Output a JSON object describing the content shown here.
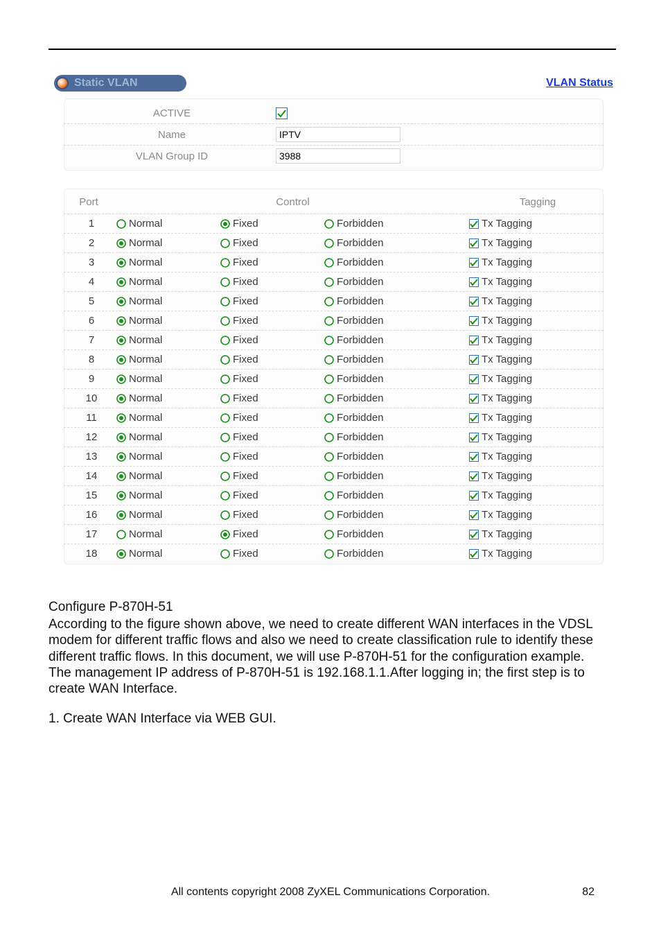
{
  "header": {
    "tab_label": "Static VLAN",
    "link_label": "VLAN Status"
  },
  "form": {
    "active_label": "ACTIVE",
    "active_checked": true,
    "name_label": "Name",
    "name_value": "IPTV",
    "group_label": "VLAN Group ID",
    "group_value": "3988"
  },
  "table": {
    "head_port": "Port",
    "head_control": "Control",
    "head_tagging": "Tagging",
    "opt_normal": "Normal",
    "opt_fixed": "Fixed",
    "opt_forbidden": "Forbidden",
    "tag_label": "Tx Tagging",
    "rows": [
      {
        "port": "1",
        "selected": "fixed",
        "tag": true
      },
      {
        "port": "2",
        "selected": "normal",
        "tag": true
      },
      {
        "port": "3",
        "selected": "normal",
        "tag": true
      },
      {
        "port": "4",
        "selected": "normal",
        "tag": true
      },
      {
        "port": "5",
        "selected": "normal",
        "tag": true
      },
      {
        "port": "6",
        "selected": "normal",
        "tag": true
      },
      {
        "port": "7",
        "selected": "normal",
        "tag": true
      },
      {
        "port": "8",
        "selected": "normal",
        "tag": true
      },
      {
        "port": "9",
        "selected": "normal",
        "tag": true
      },
      {
        "port": "10",
        "selected": "normal",
        "tag": true
      },
      {
        "port": "11",
        "selected": "normal",
        "tag": true
      },
      {
        "port": "12",
        "selected": "normal",
        "tag": true
      },
      {
        "port": "13",
        "selected": "normal",
        "tag": true
      },
      {
        "port": "14",
        "selected": "normal",
        "tag": true
      },
      {
        "port": "15",
        "selected": "normal",
        "tag": true
      },
      {
        "port": "16",
        "selected": "normal",
        "tag": true
      },
      {
        "port": "17",
        "selected": "fixed",
        "tag": true
      },
      {
        "port": "18",
        "selected": "normal",
        "tag": true
      }
    ]
  },
  "body": {
    "title": "Configure P-870H-51",
    "p1": "According to the figure shown above, we need to create different WAN interfaces in the VDSL modem for different traffic flows and also we need to create classification rule to identify these different traffic flows. In this document, we will use P-870H-51 for the configuration example.",
    "p2": "The management IP address of P-870H-51 is 192.168.1.1.After logging in; the first step is to create WAN Interface.",
    "list1": "1.  Create WAN Interface via WEB GUI."
  },
  "footer": {
    "copyright": "All contents copyright 2008 ZyXEL Communications Corporation.",
    "page": "82"
  }
}
